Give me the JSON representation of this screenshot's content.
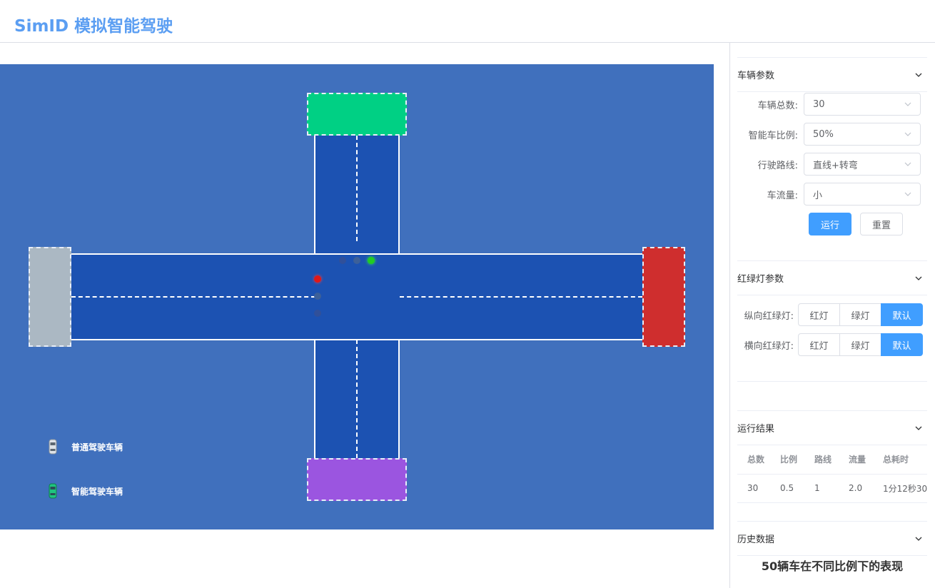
{
  "app": {
    "title": "SimID 模拟智能驾驶"
  },
  "colors": {
    "scene_bg": "#4070bd",
    "road": "#1c52b2",
    "zone_top": "#00d084",
    "zone_bottom": "#9b55e0",
    "zone_left": "#abb8c3",
    "zone_right": "#cf2e2e",
    "primary": "#409eff",
    "title": "#5b9ef2"
  },
  "legend": {
    "normal": {
      "label": "普通驾驶车辆",
      "icon": "gray-car-icon"
    },
    "smart": {
      "label": "智能驾驶车辆",
      "icon": "green-car-icon"
    }
  },
  "vehicle_params": {
    "heading": "车辆参数",
    "fields": [
      {
        "label": "车辆总数:",
        "value": "30"
      },
      {
        "label": "智能车比例:",
        "value": "50%"
      },
      {
        "label": "行驶路线:",
        "value": "直线+转弯"
      },
      {
        "label": "车流量:",
        "value": "小"
      }
    ],
    "run_label": "运行",
    "reset_label": "重置"
  },
  "light_params": {
    "heading": "红绿灯参数",
    "rows": [
      {
        "label": "纵向红绿灯:",
        "options": [
          "红灯",
          "绿灯",
          "默认"
        ],
        "selected": "默认"
      },
      {
        "label": "横向红绿灯:",
        "options": [
          "红灯",
          "绿灯",
          "默认"
        ],
        "selected": "默认"
      }
    ]
  },
  "results": {
    "heading": "运行结果",
    "columns": [
      "总数",
      "比例",
      "路线",
      "流量",
      "总耗时"
    ],
    "rows": [
      [
        "30",
        "0.5",
        "1",
        "2.0",
        "1分12秒30"
      ]
    ]
  },
  "history": {
    "heading": "历史数据",
    "chart_title": "50辆车在不同比例下的表现"
  }
}
